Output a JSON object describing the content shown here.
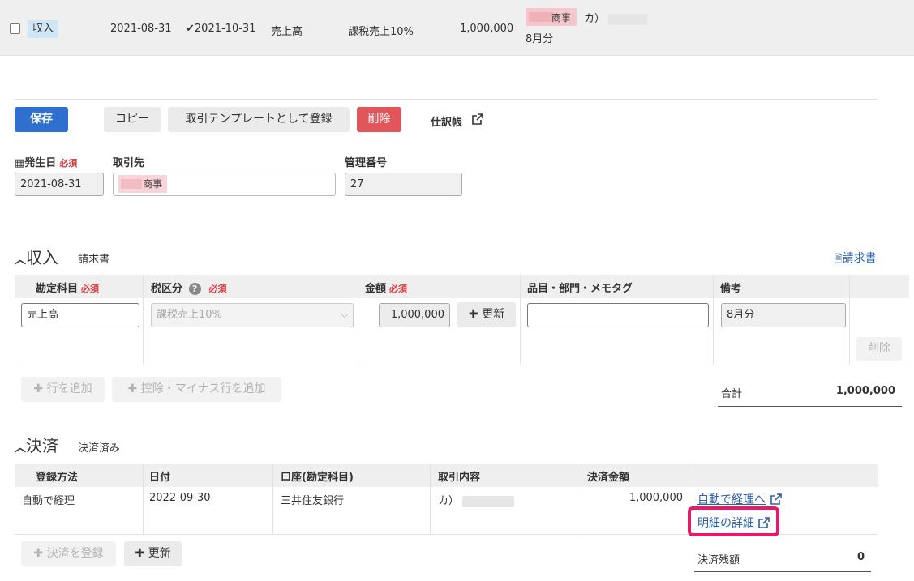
{
  "summary": {
    "kind": "収入",
    "issue_date": "2021-08-31",
    "settle_date": "2021-10-31",
    "account": "売上高",
    "tax": "課税売上10%",
    "amount": "1,000,000",
    "partner_suffix": "商事",
    "counterparty_prefix": "カ）",
    "memo": "8月分"
  },
  "toolbar": {
    "save": "保存",
    "copy": "コピー",
    "register_template": "取引テンプレートとして登録",
    "delete": "削除",
    "journal": "仕訳帳"
  },
  "form": {
    "issue_date_label": "発生日",
    "required": "必須",
    "issue_date_value": "2021-08-31",
    "partner_label": "取引先",
    "partner_suffix": "商事",
    "mgmt_label": "管理番号",
    "mgmt_value": "27"
  },
  "income": {
    "title": "収入",
    "subtitle": "請求書",
    "invoice_link": "請求書",
    "headers": {
      "account": "勘定科目",
      "tax": "税区分",
      "amount": "金額",
      "item": "品目・部門・メモタグ",
      "note": "備考"
    },
    "row": {
      "account": "売上高",
      "tax": "課税売上10%",
      "amount": "1,000,000",
      "update": "更新",
      "item": "",
      "note": "8月分",
      "delete": "削除"
    },
    "add_row": "行を追加",
    "add_minus_row": "控除・マイナス行を追加",
    "total_label": "合計",
    "total_value": "1,000,000"
  },
  "settlement": {
    "title": "決済",
    "subtitle": "決済済み",
    "headers": {
      "method": "登録方法",
      "date": "日付",
      "account": "口座(勘定科目)",
      "content": "取引内容",
      "amount": "決済金額"
    },
    "row": {
      "method": "自動で経理",
      "date": "2022-09-30",
      "account": "三井住友銀行",
      "content_prefix": "カ）",
      "amount": "1,000,000",
      "link_auto": "自動で経理へ",
      "link_detail": "明細の詳細"
    },
    "register": "決済を登録",
    "update": "更新",
    "balance_label": "決済残額",
    "balance_value": "0"
  }
}
